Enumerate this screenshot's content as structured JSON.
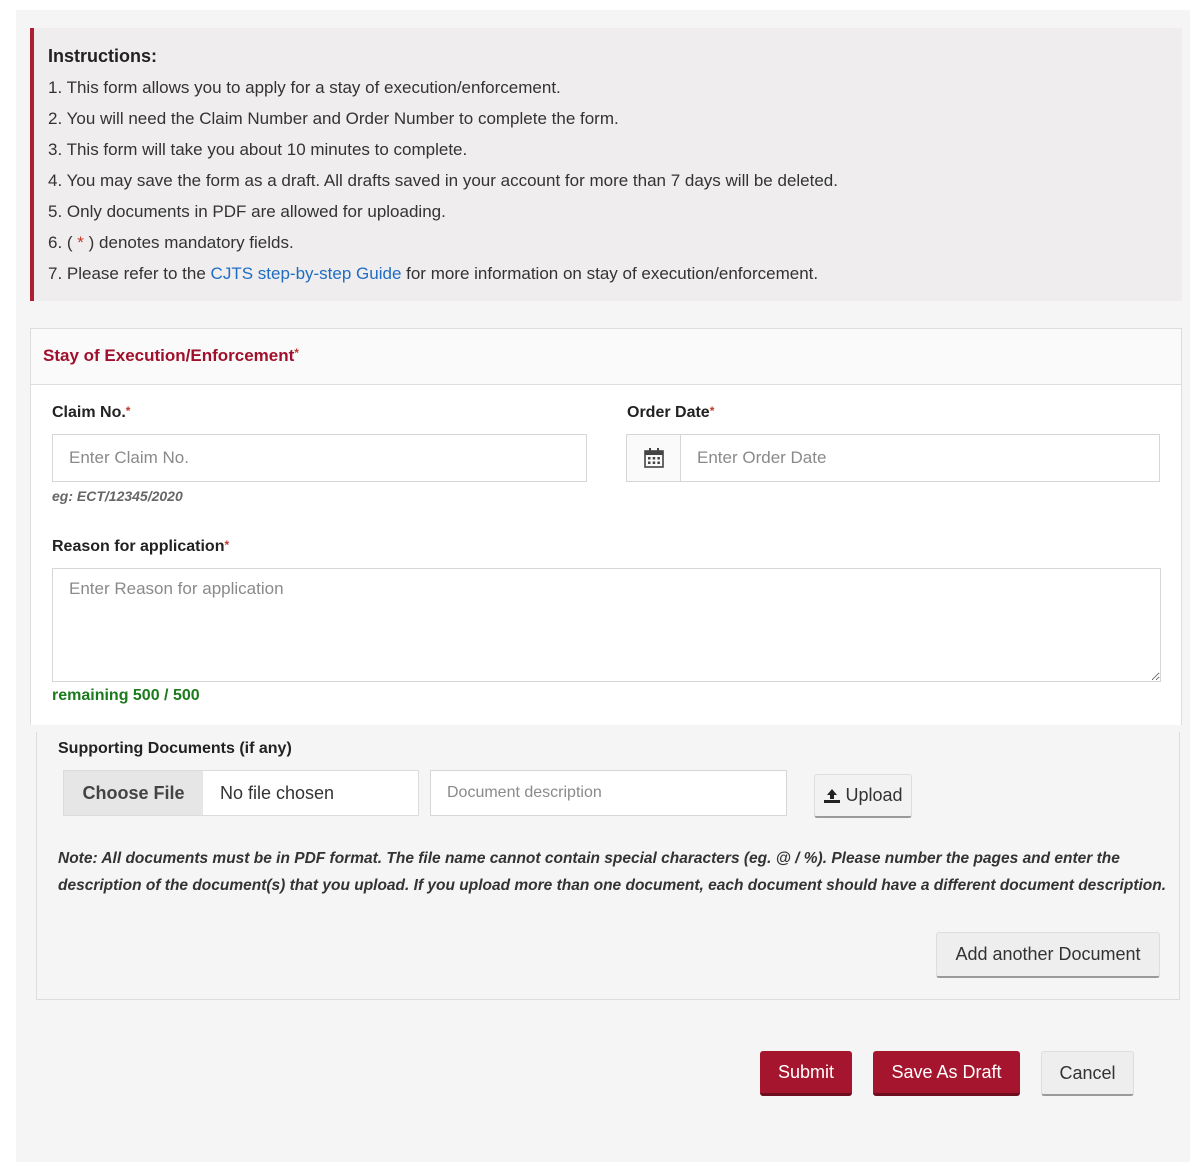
{
  "instructions": {
    "title": "Instructions:",
    "items": [
      "1. This form allows you to apply for a stay of execution/enforcement.",
      "2. You will need the Claim Number and Order Number to complete the form.",
      "3. This form will take you about 10 minutes to complete.",
      "4. You may save the form as a draft. All drafts saved in your account for more than 7 days will be deleted.",
      "5. Only documents in PDF are allowed for uploading."
    ],
    "item6_prefix": "6. ( ",
    "item6_asterisk": "*",
    "item6_suffix": " ) denotes mandatory fields.",
    "item7_prefix": "7. Please refer to the ",
    "item7_link": "CJTS step-by-step Guide",
    "item7_suffix": " for more information on stay of execution/enforcement."
  },
  "form": {
    "section_title": "Stay of Execution/Enforcement",
    "required_mark": "*",
    "claim_no": {
      "label": "Claim No.",
      "placeholder": "Enter Claim No.",
      "value": "",
      "hint": "eg: ECT/12345/2020"
    },
    "order_date": {
      "label": "Order Date",
      "placeholder": "Enter Order Date",
      "value": "",
      "icon": "calendar-icon"
    },
    "reason": {
      "label": "Reason for application",
      "placeholder": "Enter Reason for application",
      "value": "",
      "remaining": "remaining 500 / 500"
    }
  },
  "supporting_docs": {
    "label": "Supporting Documents (if any)",
    "choose_file_label": "Choose File",
    "file_status": "No file chosen",
    "description_placeholder": "Document description",
    "upload_label": "Upload",
    "upload_icon": "upload-icon",
    "note": "Note: All documents must be in PDF format. The file name cannot contain special characters (eg. @ / %). Please number the pages and enter the description of the document(s) that you upload. If you upload more than one document, each document should have a different document description.",
    "add_another_label": "Add another Document"
  },
  "actions": {
    "submit": "Submit",
    "save_draft": "Save As Draft",
    "cancel": "Cancel"
  },
  "colors": {
    "brand": "#a5162e",
    "link": "#1f6dc2",
    "success": "#1b7a1b",
    "required": "#c0392b"
  }
}
